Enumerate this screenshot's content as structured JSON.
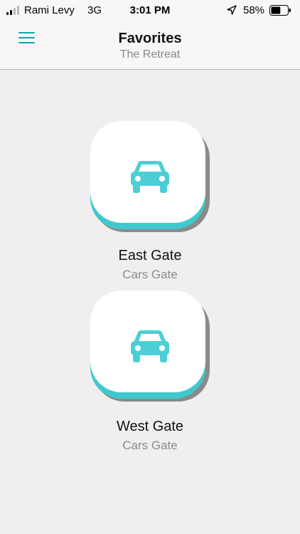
{
  "status_bar": {
    "carrier": "Rami Levy",
    "network": "3G",
    "time": "3:01 PM",
    "battery_percent": "58%",
    "battery_level": 0.58,
    "signal_bars": 2
  },
  "header": {
    "menu_icon": "hamburger-menu-icon",
    "title": "Favorites",
    "subtitle": "The Retreat"
  },
  "gates": [
    {
      "name": "East Gate",
      "type": "Cars Gate",
      "icon": "car-icon"
    },
    {
      "name": "West Gate",
      "type": "Cars Gate",
      "icon": "car-icon"
    }
  ],
  "colors": {
    "accent": "#1ba0ab",
    "button_accent": "#3fc9cf",
    "icon": "#4bcfd5",
    "background": "#efefef"
  }
}
